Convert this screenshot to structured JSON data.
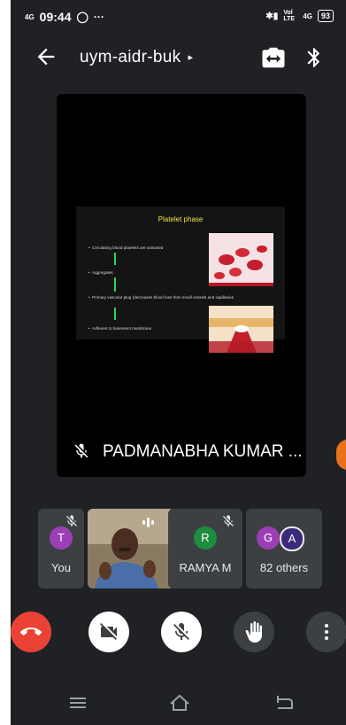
{
  "status": {
    "network": "4G",
    "time": "09:44",
    "lte": "Vol LTE",
    "net2": "4G",
    "battery": "93"
  },
  "meeting": {
    "code": "uym-aidr-buk",
    "caret": "▸"
  },
  "slide": {
    "title": "Platelet phase",
    "bullets": [
      "Circulating blood platelets are activated",
      "Aggregates",
      "Primary vascular plug (decreases blood loss from small vessels and capillaries",
      "Adheres to basement membrane"
    ]
  },
  "speaker": {
    "name": "PADMANABHA KUMAR ..."
  },
  "participants": {
    "you": {
      "initial": "T",
      "label": "You"
    },
    "ramya": {
      "initial": "R",
      "label": "RAMYA M"
    },
    "others": {
      "initial1": "G",
      "initial2": "A",
      "label": "82 others"
    }
  },
  "colors": {
    "background": "#202124",
    "end_call": "#ea4335",
    "avatar_you": "#9c3fb5",
    "avatar_ramya": "#1e8e3e",
    "avatar_g": "#9c3fb5",
    "avatar_a": "#3b2a7a",
    "slide_title": "#f4e44f"
  },
  "icons": {
    "back": "arrow-left-icon",
    "switch_camera": "switch-camera-icon",
    "bluetooth": "bluetooth-icon",
    "mic_off": "mic-off-icon",
    "end_call": "phone-hangup-icon",
    "camera_off": "videocam-off-icon",
    "raise_hand": "hand-icon",
    "more": "more-vert-icon"
  }
}
